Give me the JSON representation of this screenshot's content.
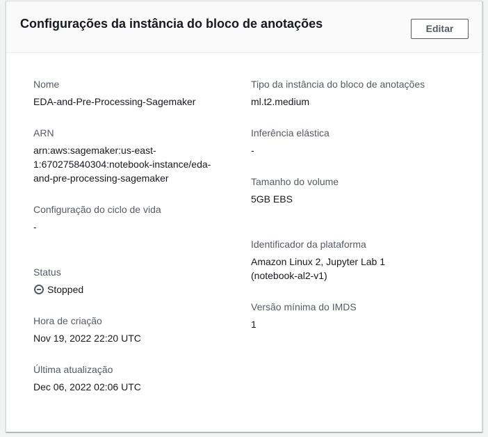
{
  "panel": {
    "title": "Configurações da instância do bloco de anotações",
    "edit_label": "Editar"
  },
  "left_column": {
    "name": {
      "label": "Nome",
      "value": "EDA-and-Pre-Processing-Sagemaker"
    },
    "arn": {
      "label": "ARN",
      "value": "arn:aws:sagemaker:us-east-1:670275840304:notebook-instance/eda-and-pre-processing-sagemaker"
    },
    "lifecycle": {
      "label": "Configuração do ciclo de vida",
      "value": "-"
    },
    "status": {
      "label": "Status",
      "value": "Stopped",
      "icon": "stopped-icon"
    },
    "creation_time": {
      "label": "Hora de criação",
      "value": "Nov 19, 2022 22:20 UTC"
    },
    "last_update": {
      "label": "Última atualização",
      "value": "Dec 06, 2022 02:06 UTC"
    }
  },
  "right_column": {
    "instance_type": {
      "label": "Tipo da instância do bloco de anotações",
      "value": "ml.t2.medium"
    },
    "elastic_inference": {
      "label": "Inferência elástica",
      "value": "-"
    },
    "volume_size": {
      "label": "Tamanho do volume",
      "value": "5GB EBS"
    },
    "platform_id": {
      "label": "Identificador da plataforma",
      "value": "Amazon Linux 2, Jupyter Lab 1 (notebook-al2-v1)"
    },
    "imds_min_version": {
      "label": "Versão mínima do IMDS",
      "value": "1"
    }
  },
  "colors": {
    "label_text": "#545b64",
    "value_text": "#16191f",
    "header_bg": "#fafafa",
    "page_bg": "#f2f3f3"
  }
}
